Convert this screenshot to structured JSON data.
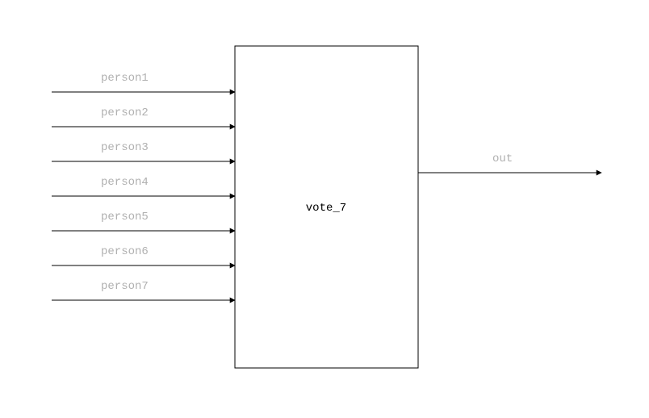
{
  "block": {
    "name": "vote_7"
  },
  "inputs": [
    {
      "label": "person1"
    },
    {
      "label": "person2"
    },
    {
      "label": "person3"
    },
    {
      "label": "person4"
    },
    {
      "label": "person5"
    },
    {
      "label": "person6"
    },
    {
      "label": "person7"
    }
  ],
  "outputs": [
    {
      "label": "out"
    }
  ]
}
